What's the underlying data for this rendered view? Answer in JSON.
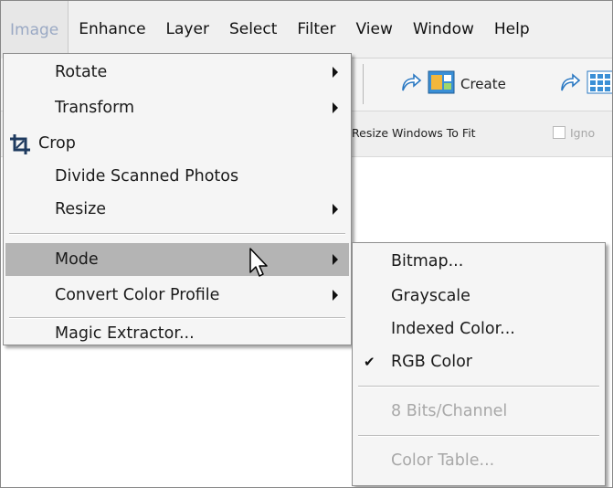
{
  "menubar": {
    "items": [
      "Image",
      "Enhance",
      "Layer",
      "Select",
      "Filter",
      "View",
      "Window",
      "Help"
    ]
  },
  "toolbar": {
    "create_label": "Create",
    "resize_label": "Resize Windows To Fit",
    "ignore_label": "Igno"
  },
  "image_menu": {
    "items": [
      {
        "label": "Rotate",
        "submenu": true
      },
      {
        "label": "Transform",
        "submenu": true
      },
      {
        "label": "Crop",
        "icon": "crop-icon"
      },
      {
        "label": "Divide Scanned Photos"
      },
      {
        "label": "Resize",
        "submenu": true
      },
      {
        "label": "Mode",
        "submenu": true,
        "highlighted": true
      },
      {
        "label": "Convert Color Profile",
        "submenu": true
      },
      {
        "label": "Magic Extractor..."
      }
    ]
  },
  "mode_submenu": {
    "items": [
      {
        "label": "Bitmap..."
      },
      {
        "label": "Grayscale"
      },
      {
        "label": "Indexed Color..."
      },
      {
        "label": "RGB Color",
        "checked": true
      },
      {
        "label": "8 Bits/Channel",
        "disabled": true
      },
      {
        "label": "Color Table...",
        "disabled": true
      }
    ]
  },
  "colors": {
    "menu_bg": "#f5f5f5",
    "highlight": "#b4b4b4",
    "active_menu_text": "#9aa9c4",
    "disabled_text": "#a8a8a8"
  }
}
